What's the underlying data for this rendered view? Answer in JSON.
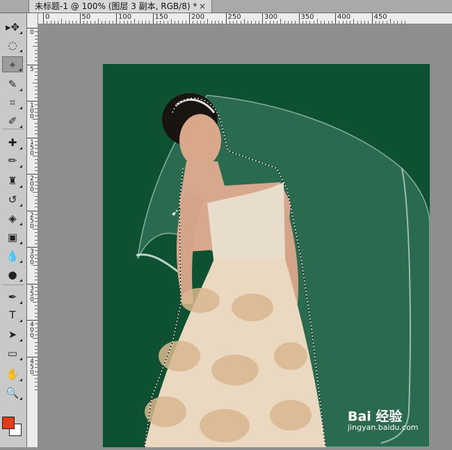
{
  "tab": {
    "title": "未标题-1 @ 100% (图层 3 副本, RGB/8) *",
    "close": "×"
  },
  "ruler": {
    "h_labels": [
      "0",
      "50",
      "100",
      "150",
      "200",
      "250",
      "300",
      "350",
      "400",
      "450"
    ],
    "v_labels": [
      "0",
      "5",
      "1\n0\n0",
      "1\n5\n0",
      "2\n0\n0",
      "2\n5\n0",
      "3\n0\n0",
      "3\n5\n0",
      "4\n0\n0",
      "4\n5\n0"
    ]
  },
  "tools": [
    {
      "name": "move-tool",
      "glyph": "▸✥"
    },
    {
      "name": "marquee-tool",
      "glyph": "◌"
    },
    {
      "name": "polygonal-lasso-tool",
      "glyph": "⌖",
      "active": true
    },
    {
      "name": "quick-selection-tool",
      "glyph": "✎"
    },
    {
      "name": "crop-tool",
      "glyph": "⌗"
    },
    {
      "name": "eyedropper-tool",
      "glyph": "✐"
    },
    {
      "name": "healing-brush-tool",
      "glyph": "✚"
    },
    {
      "name": "brush-tool",
      "glyph": "✏"
    },
    {
      "name": "clone-stamp-tool",
      "glyph": "♜"
    },
    {
      "name": "history-brush-tool",
      "glyph": "↺"
    },
    {
      "name": "eraser-tool",
      "glyph": "◈"
    },
    {
      "name": "gradient-tool",
      "glyph": "▣"
    },
    {
      "name": "blur-tool",
      "glyph": "💧"
    },
    {
      "name": "dodge-tool",
      "glyph": "●"
    },
    {
      "name": "pen-tool",
      "glyph": "✒"
    },
    {
      "name": "type-tool",
      "glyph": "T"
    },
    {
      "name": "path-selection-tool",
      "glyph": "➤"
    },
    {
      "name": "shape-tool",
      "glyph": "▭"
    },
    {
      "name": "hand-tool",
      "glyph": "✋"
    },
    {
      "name": "zoom-tool",
      "glyph": "🔍"
    }
  ],
  "colors": {
    "foreground": "#e33a17",
    "background": "#ffffff",
    "canvas_bg": "#0e5032"
  },
  "watermark": {
    "brand": "Bai 经验",
    "url": "jingyan.baidu.com"
  }
}
